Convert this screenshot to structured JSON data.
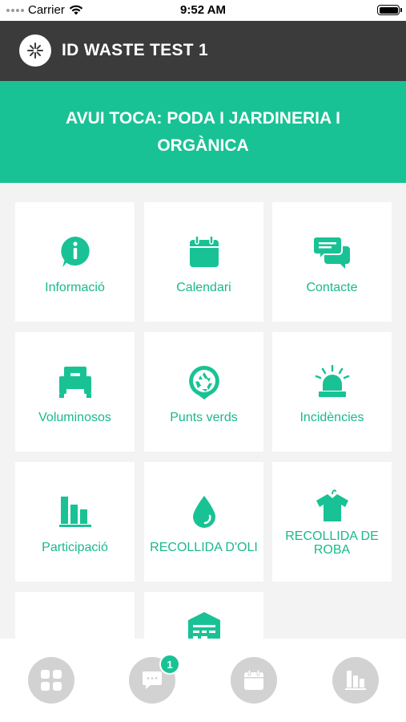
{
  "status_bar": {
    "carrier": "Carrier",
    "time": "9:52 AM"
  },
  "header": {
    "title": "ID WASTE TEST 1"
  },
  "banner": {
    "text": "AVUI TOCA: PODA I JARDINERIA I ORGÀNICA"
  },
  "tiles": [
    {
      "label": "Informació",
      "icon": "info-icon"
    },
    {
      "label": "Calendari",
      "icon": "calendar-icon"
    },
    {
      "label": "Contacte",
      "icon": "chat-icon"
    },
    {
      "label": "Voluminosos",
      "icon": "armchair-icon"
    },
    {
      "label": "Punts verds",
      "icon": "recycle-pin-icon"
    },
    {
      "label": "Incidències",
      "icon": "siren-icon"
    },
    {
      "label": "Participació",
      "icon": "bar-chart-icon"
    },
    {
      "label": "RECOLLIDA D'OLI",
      "icon": "oil-drop-icon"
    },
    {
      "label": "RECOLLIDA DE ROBA",
      "icon": "shirt-icon"
    }
  ],
  "tab_bar": {
    "tabs": [
      {
        "icon": "grid-icon"
      },
      {
        "icon": "chat-bubble-icon",
        "badge": "1"
      },
      {
        "icon": "calendar-icon"
      },
      {
        "icon": "bar-chart-icon"
      }
    ]
  },
  "colors": {
    "accent": "#19c295",
    "header": "#3b3b3b",
    "tile_text": "#19b98c",
    "tab_bg": "#d2d2d2"
  }
}
